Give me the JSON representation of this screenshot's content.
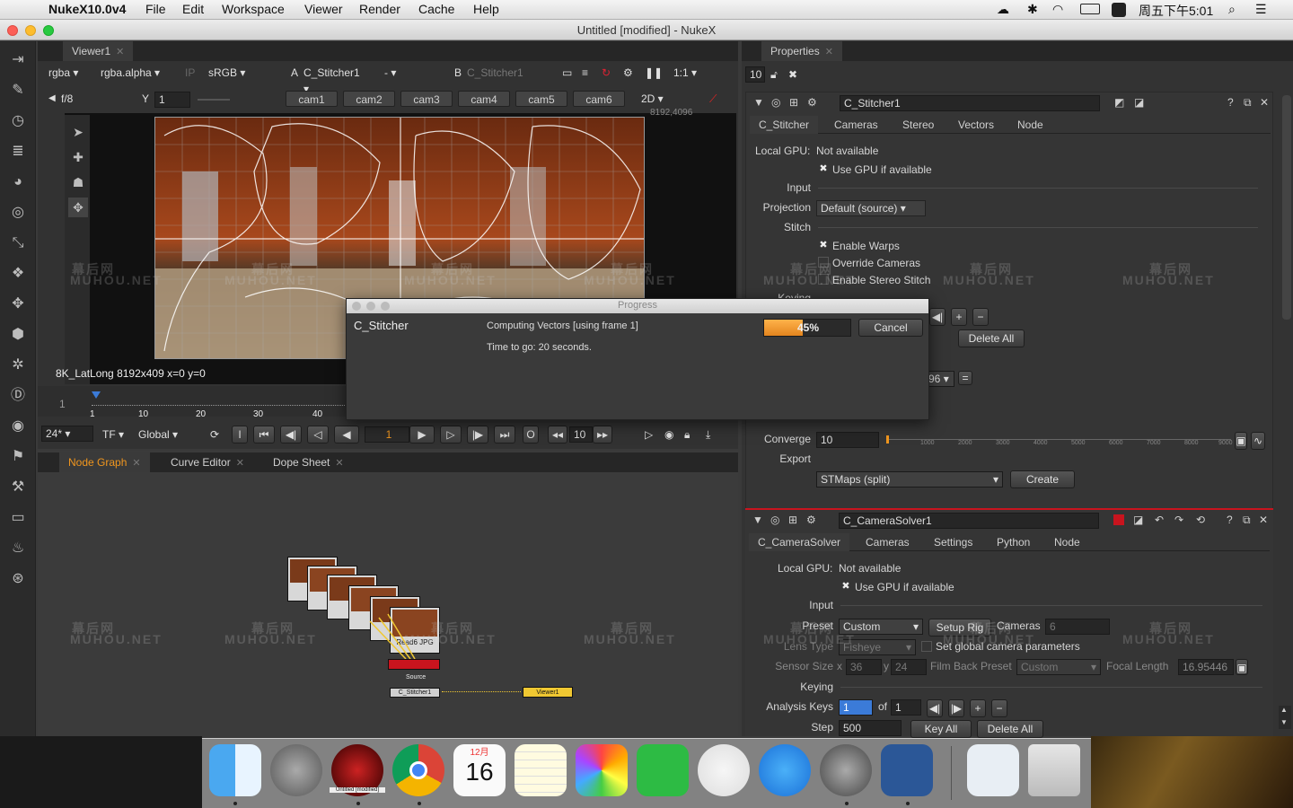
{
  "menubar": {
    "app_name": "NukeX10.0v4",
    "items": [
      "File",
      "Edit",
      "Workspace",
      "Viewer",
      "Render",
      "Cache",
      "Help"
    ],
    "clock": "周五下午5:01"
  },
  "window": {
    "title": "Untitled [modified] - NukeX"
  },
  "viewer": {
    "tab": "Viewer1",
    "channels": "rgba",
    "alpha": "rgba.alpha",
    "ip": "IP",
    "colorspace": "sRGB",
    "a_label": "A",
    "a_input": "C_Stitcher1",
    "a_op": "-",
    "b_label": "B",
    "b_input": "C_Stitcher1",
    "zoom": "1:1",
    "fstop": "f/8",
    "y_label": "Y",
    "y_value": "1",
    "cams": [
      "cam1",
      "cam2",
      "cam3",
      "cam4",
      "cam5",
      "cam6"
    ],
    "view_mode": "2D",
    "format_info": "8K_LatLong 8192x409  x=0 y=0",
    "coord_readout": "8192,4096"
  },
  "timeline": {
    "start": "1",
    "ticks": [
      "1",
      "10",
      "20",
      "30",
      "40"
    ],
    "fps": "24*",
    "tf": "TF",
    "scope": "Global",
    "in_marker": "I",
    "out_marker": "O",
    "current_frame": "1",
    "step": "10"
  },
  "bottom_tabs": [
    "Node Graph",
    "Curve Editor",
    "Dope Sheet"
  ],
  "nodes": {
    "read": "Read6 JPG",
    "source_label": "Source",
    "stitcher": "C_Stitcher1",
    "viewer": "Viewer1"
  },
  "properties": {
    "tab": "Properties",
    "max_panels": "10",
    "stitcher": {
      "name": "C_Stitcher1",
      "tabs": [
        "C_Stitcher",
        "Cameras",
        "Stereo",
        "Vectors",
        "Node"
      ],
      "local_gpu_label": "Local GPU:",
      "local_gpu_value": "Not available",
      "use_gpu": "Use GPU if available",
      "input_label": "Input",
      "projection_label": "Projection",
      "projection_value": "Default (source)",
      "stitch_label": "Stitch",
      "enable_warps": "Enable Warps",
      "override_cameras": "Override Cameras",
      "enable_stereo": "Enable Stereo Stitch",
      "keying_label": "Keying",
      "delete_all": "Delete All",
      "filter_value": "96",
      "converge_label": "Converge",
      "converge_value": "10",
      "converge_ticks": [
        "1000",
        "2000",
        "3000",
        "4000",
        "5000",
        "6000",
        "7000",
        "8000",
        "9000"
      ],
      "export_label": "Export",
      "export_value": "STMaps (split)",
      "create": "Create"
    },
    "camerasolver": {
      "name": "C_CameraSolver1",
      "tabs": [
        "C_CameraSolver",
        "Cameras",
        "Settings",
        "Python",
        "Node"
      ],
      "local_gpu_label": "Local GPU:",
      "local_gpu_value": "Not available",
      "use_gpu": "Use GPU if available",
      "input_label": "Input",
      "preset_label": "Preset",
      "preset_value": "Custom",
      "setup_rig": "Setup Rig",
      "cameras_label": "Cameras",
      "cameras_value": "6",
      "lens_type_label": "Lens Type",
      "lens_type_value": "Fisheye",
      "set_global": "Set global camera parameters",
      "sensor_size_label": "Sensor Size",
      "sensor_x_label": "x",
      "sensor_x": "36",
      "sensor_y_label": "y",
      "sensor_y": "24",
      "film_back_label": "Film Back Preset",
      "film_back_value": "Custom",
      "focal_label": "Focal Length",
      "focal_value": "16.95446",
      "keying_label": "Keying",
      "analysis_keys_label": "Analysis Keys",
      "analysis_keys_value": "1",
      "of_label": "of",
      "of_value": "1",
      "step_label": "Step",
      "step_value": "500",
      "key_all": "Key All",
      "delete_all": "Delete All"
    }
  },
  "progress": {
    "title": "Progress",
    "node": "C_Stitcher",
    "task": "Computing Vectors [using frame 1]",
    "eta": "Time to go: 20 seconds.",
    "percent_label": "45%",
    "percent": 0.45,
    "cancel": "Cancel"
  },
  "dock": {
    "apps": [
      "finder-icon",
      "launchpad-icon",
      "nuke-icon",
      "chrome-icon",
      "calendar-icon",
      "notes-icon",
      "photos-icon",
      "facetime-icon",
      "itunes-icon",
      "appstore-icon",
      "sysprefs-icon",
      "word-icon",
      "documents-icon",
      "trash-icon"
    ],
    "nuke_label": "Untitled [modified]",
    "calendar_month": "12月",
    "calendar_day": "16"
  },
  "watermark": {
    "cn": "幕后网",
    "en": "MUHOU.NET"
  },
  "colors": {
    "accent_orange": "#f0961e",
    "node_red": "#c8141e",
    "viewer_node": "#f0c832",
    "selection_blue": "#3b7bd8"
  }
}
